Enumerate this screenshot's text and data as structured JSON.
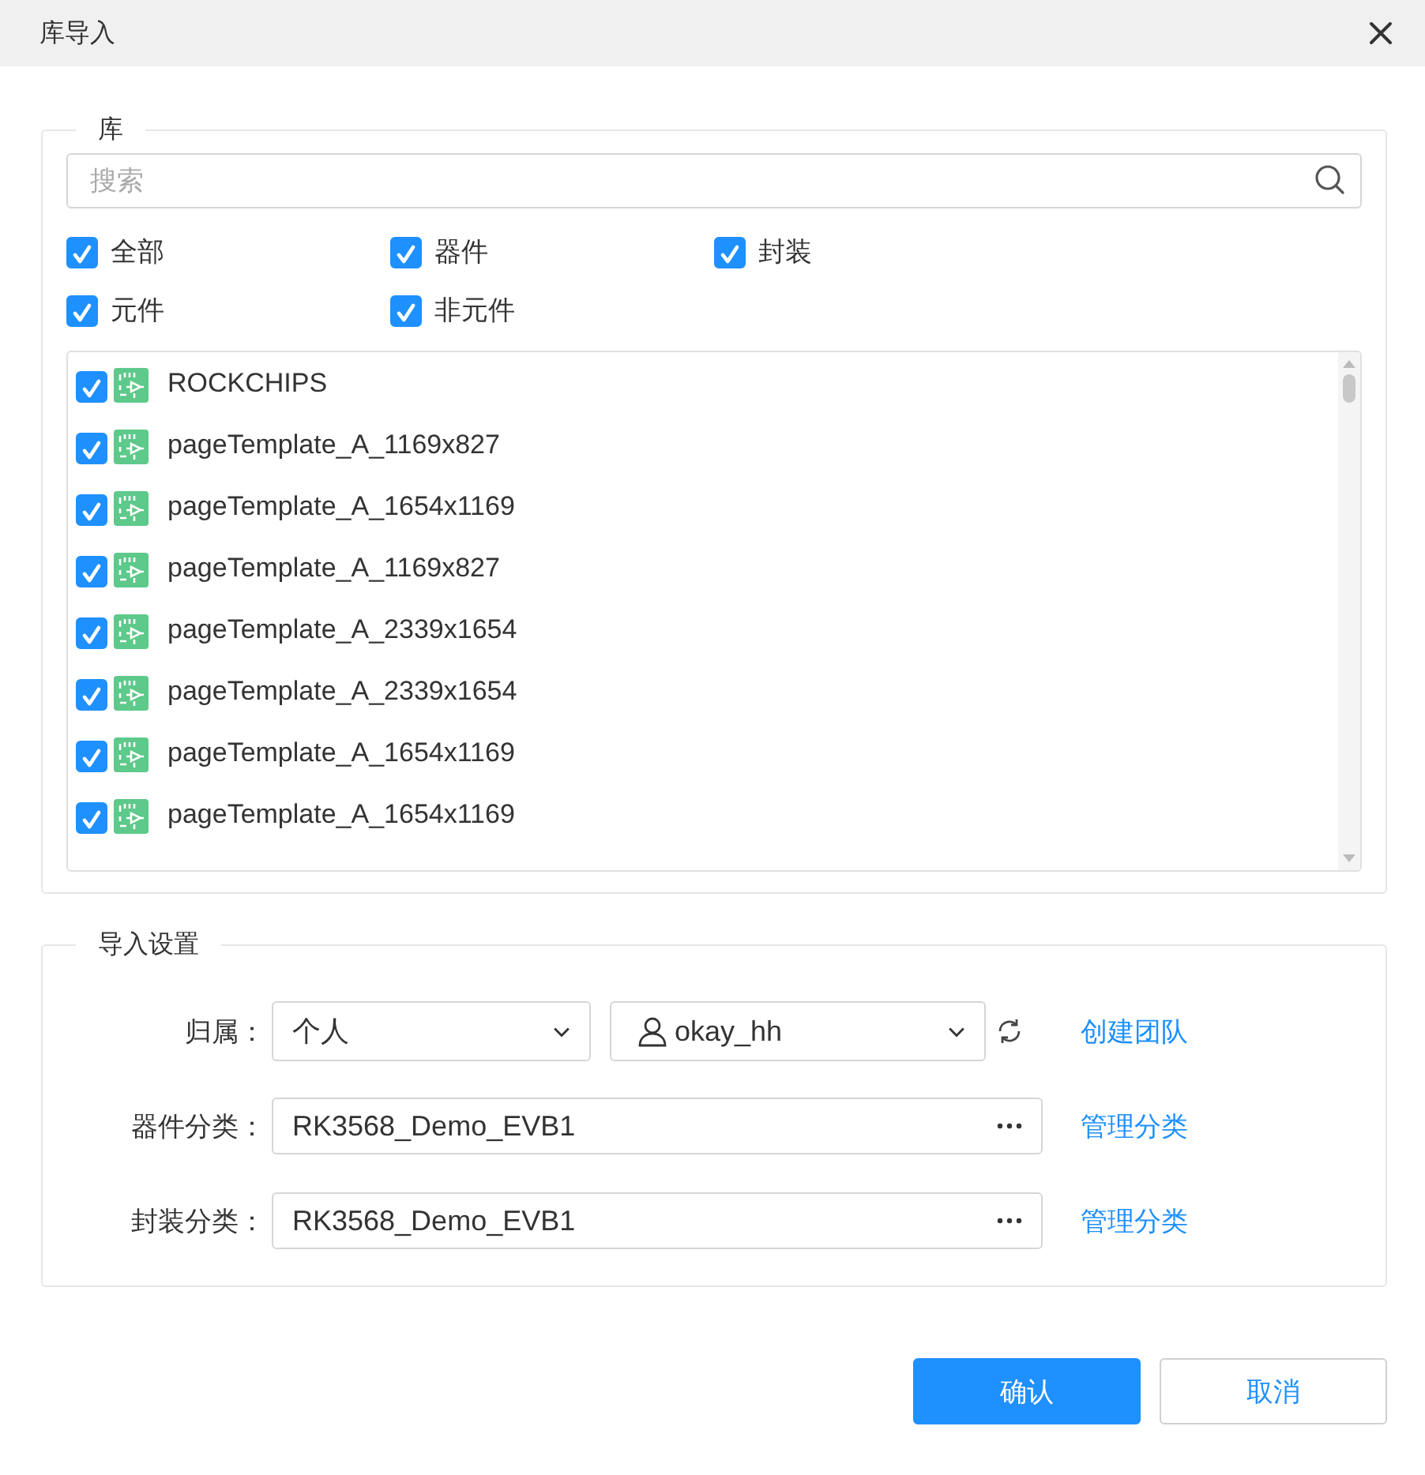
{
  "dialog": {
    "title": "库导入"
  },
  "library": {
    "legend": "库",
    "search": {
      "placeholder": "搜索"
    },
    "filters": [
      {
        "label": "全部",
        "checked": true
      },
      {
        "label": "器件",
        "checked": true
      },
      {
        "label": "封装",
        "checked": true
      },
      {
        "label": "元件",
        "checked": true
      },
      {
        "label": "非元件",
        "checked": true
      }
    ],
    "items": [
      {
        "name": "ROCKCHIPS",
        "checked": true
      },
      {
        "name": "pageTemplate_A_1169x827",
        "checked": true
      },
      {
        "name": "pageTemplate_A_1654x1169",
        "checked": true
      },
      {
        "name": "pageTemplate_A_1169x827",
        "checked": true
      },
      {
        "name": "pageTemplate_A_2339x1654",
        "checked": true
      },
      {
        "name": "pageTemplate_A_2339x1654",
        "checked": true
      },
      {
        "name": "pageTemplate_A_1654x1169",
        "checked": true
      },
      {
        "name": "pageTemplate_A_1654x1169",
        "checked": true
      }
    ]
  },
  "settings": {
    "legend": "导入设置",
    "rows": [
      {
        "kind": "owner",
        "label": "归属：",
        "fields": [
          {
            "kind": "select",
            "value": "个人"
          },
          {
            "kind": "user-select",
            "value": "okay_hh"
          }
        ],
        "link": "创建团队"
      },
      {
        "kind": "category",
        "label": "器件分类：",
        "value": "RK3568_Demo_EVB1",
        "link": "管理分类"
      },
      {
        "kind": "category",
        "label": "封装分类：",
        "value": "RK3568_Demo_EVB1",
        "link": "管理分类"
      }
    ]
  },
  "buttons": [
    {
      "label": "确认",
      "kind": "primary"
    },
    {
      "label": "取消",
      "kind": "default"
    }
  ]
}
